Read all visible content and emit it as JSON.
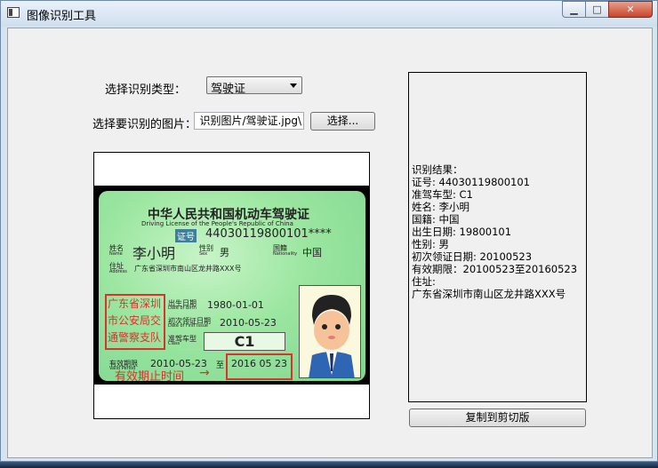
{
  "window": {
    "title": "图像识别工具",
    "min_label": "▁",
    "max_label": "□",
    "close_label": "✕"
  },
  "form": {
    "type_label": "选择识别类型：",
    "type_value": "驾驶证",
    "image_label": "选择要识别的图片：",
    "image_path": "\\识别图片/驾驶证.jpg",
    "select_button": "选择..."
  },
  "card": {
    "title_cn": "中华人民共和国机动车驾驶证",
    "title_en": "Driving License of the People's Republic of China",
    "id_tag": "证号",
    "id_number": "44030119800101****",
    "name_label": "姓名",
    "name_label_en": "Name",
    "name": "李小明",
    "sex_label": "性别",
    "sex_label_en": "Sex",
    "sex": "男",
    "nationality_label": "国籍",
    "nationality_label_en": "Nationality",
    "nationality": "中国",
    "address_label": "住址",
    "address_label_en": "Address",
    "address": "广东省深圳市南山区龙井路XXX号",
    "birth_label": "出生日期",
    "birth_label_en": "Date of Birth",
    "birth": "1980-01-01",
    "issue_label": "初次领证日期",
    "issue_label_en": "Date of First Issue",
    "issue": "2010-05-23",
    "class_label": "准驾车型",
    "class_label_en": "Class",
    "class": "C1",
    "valid_label": "有效期限",
    "valid_label_en": "Valid Period",
    "valid_from": "2010-05-23",
    "valid_to_sep": "至",
    "valid_to": "2016 05 23",
    "stamp_lines": [
      "广东省深圳",
      "市公安局交",
      "通警察支队"
    ],
    "annotation": "有效期止时间",
    "annotation_arrow": "→"
  },
  "result": {
    "lines": [
      "识别结果：",
      "   证号:  44030119800101",
      "   准驾车型:  C1",
      "   姓名:   李小明",
      "   国籍:   中国",
      "   出生日期:   19800101",
      "   性别:   男",
      "   初次领证日期:   20100523",
      "   有效期限：20100523至20160523",
      "   住址:",
      "广东省深圳市南山区龙井路XXX号"
    ]
  },
  "copy_button": "复制到剪切版"
}
